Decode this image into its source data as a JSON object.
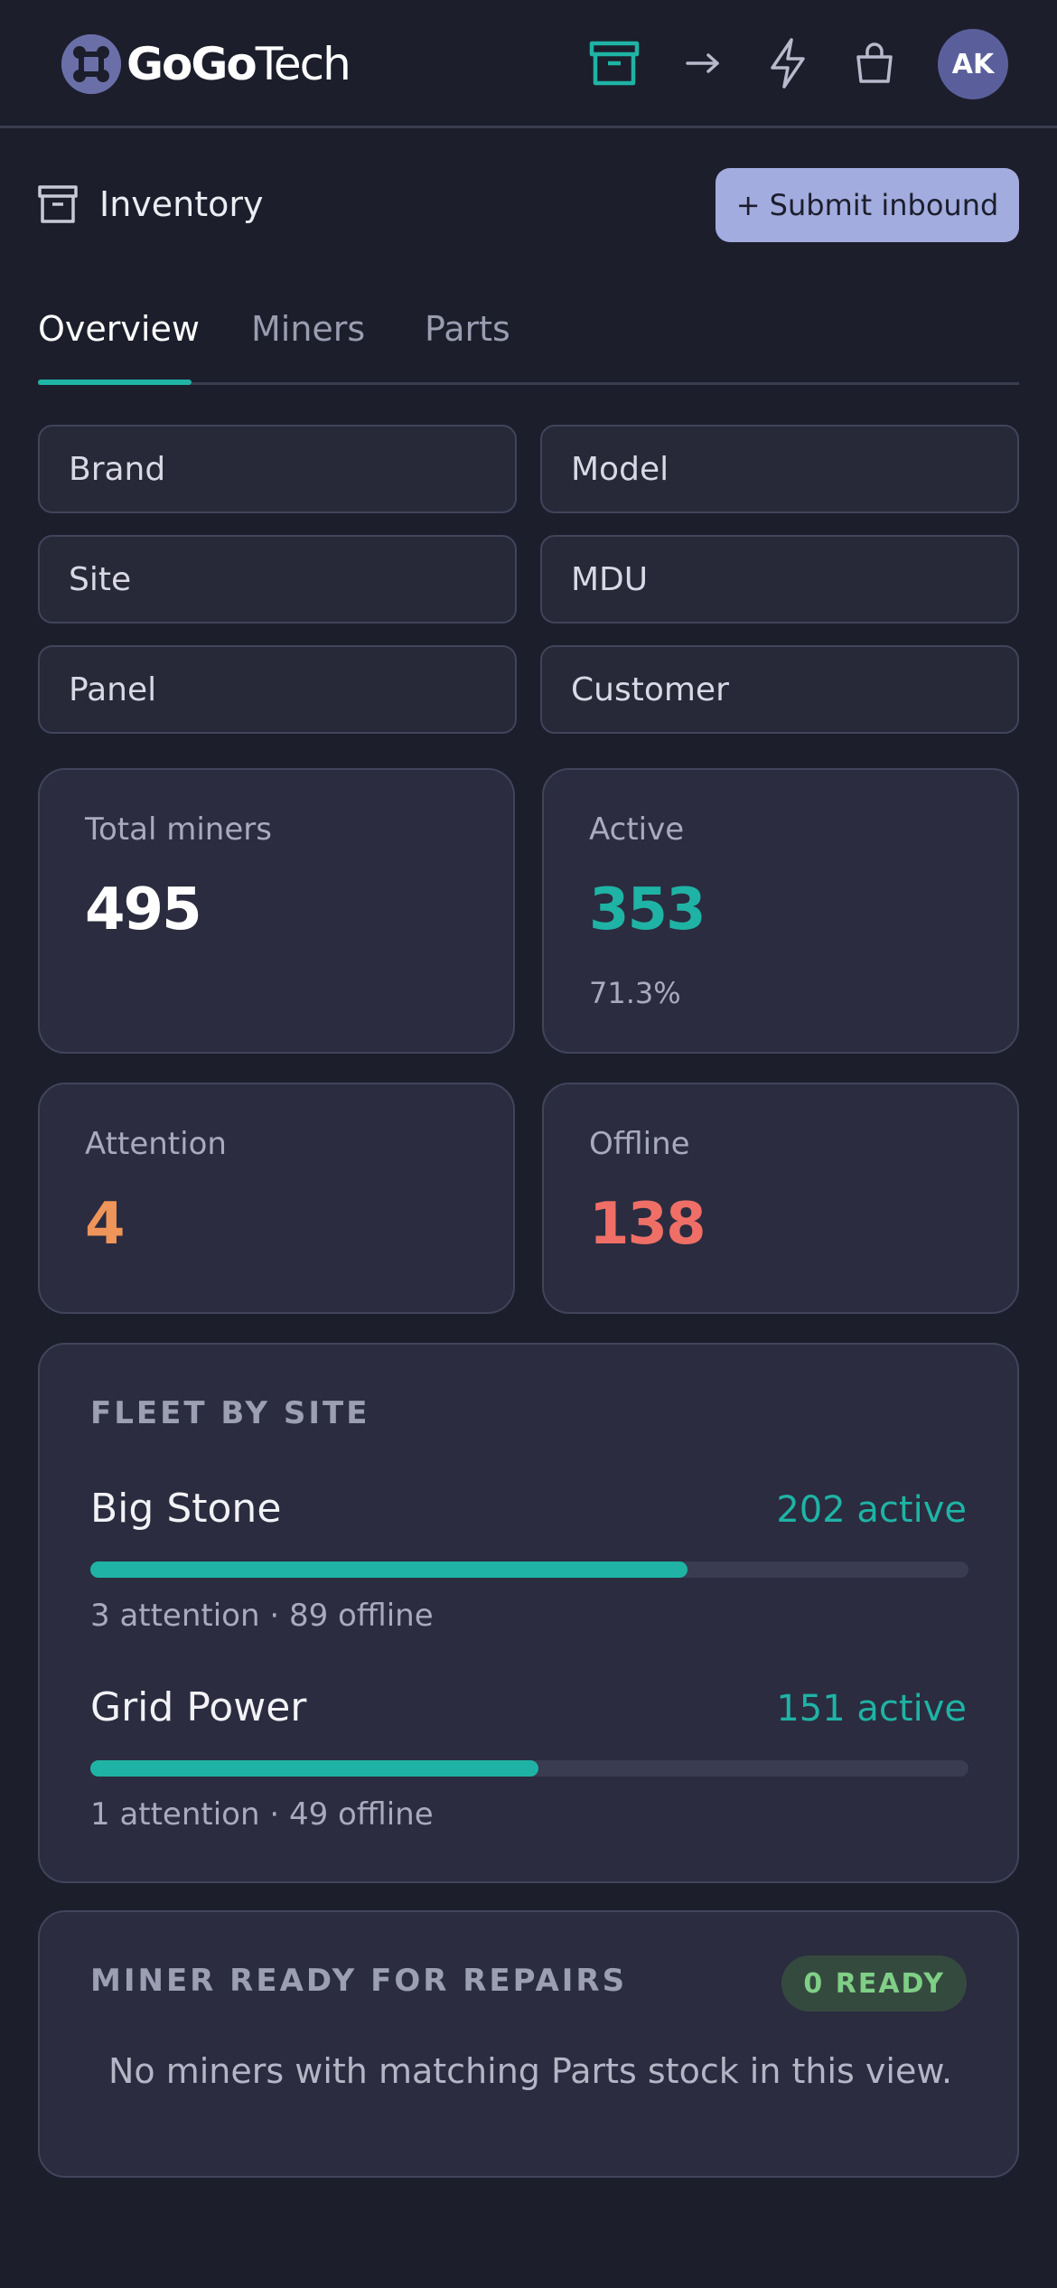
{
  "brand": {
    "name_bold": "GoGo",
    "name_light": "Tech",
    "logo_icon": "fleet-logo-icon"
  },
  "header": {
    "icons": [
      "archive-icon",
      "arrow-right-icon",
      "lightning-icon",
      "shopping-bag-icon"
    ],
    "avatar_initials": "AK",
    "accent": "#1fb3a5"
  },
  "page": {
    "icon": "archive-icon",
    "title": "Inventory",
    "submit_label": "+ Submit inbound"
  },
  "tabs": [
    {
      "label": "Overview",
      "active": true
    },
    {
      "label": "Miners",
      "active": false
    },
    {
      "label": "Parts",
      "active": false
    }
  ],
  "filters": [
    "Brand",
    "Model",
    "Site",
    "MDU",
    "Panel",
    "Customer"
  ],
  "stats": {
    "total": {
      "label": "Total miners",
      "value": "495",
      "color": "#ffffff"
    },
    "active": {
      "label": "Active",
      "value": "353",
      "sub": "71.3%",
      "color": "#1fb3a5"
    },
    "attention": {
      "label": "Attention",
      "value": "4",
      "color": "#f0955a"
    },
    "offline": {
      "label": "Offline",
      "value": "138",
      "color": "#ef6f66"
    }
  },
  "fleet": {
    "title": "FLEET BY SITE",
    "sites": [
      {
        "name": "Big Stone",
        "active_label": "202 active",
        "active_fraction": 0.68,
        "sub": "3 attention · 89 offline"
      },
      {
        "name": "Grid Power",
        "active_label": "151 active",
        "active_fraction": 0.51,
        "sub": "1 attention · 49 offline"
      }
    ]
  },
  "repairs": {
    "title": "MINER READY FOR REPAIRS",
    "badge": "0 READY",
    "empty_message": "No miners with matching Parts stock in this view."
  }
}
